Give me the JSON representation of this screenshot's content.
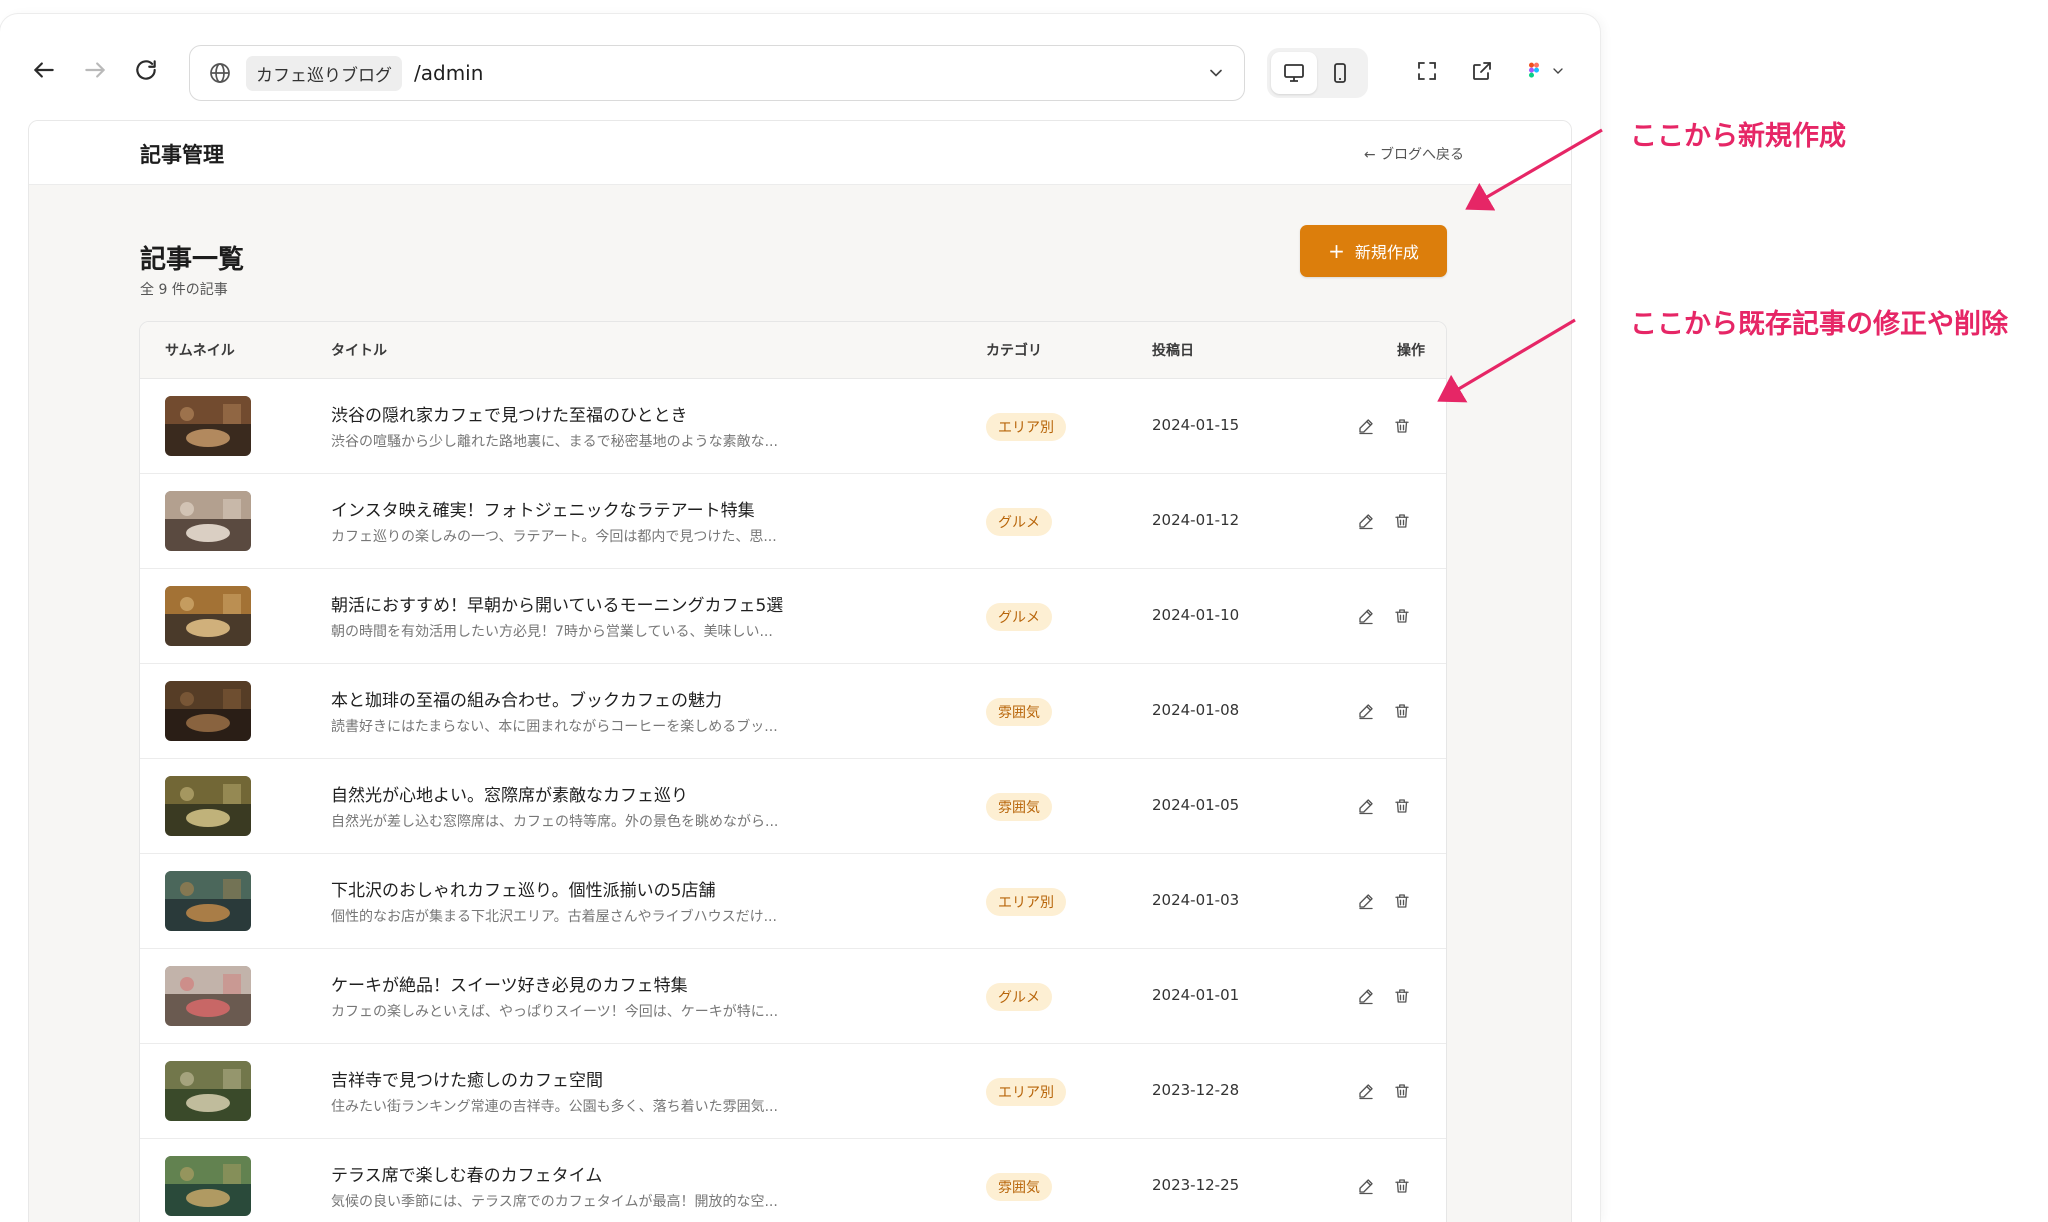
{
  "browser": {
    "site_label": "カフェ巡りブログ",
    "path": "/admin"
  },
  "page": {
    "header_title": "記事管理",
    "back_link": "← ブログへ戻る",
    "list_title": "記事一覧",
    "list_count": "全 9 件の記事",
    "new_button_label": "新規作成"
  },
  "table": {
    "headers": {
      "thumbnail": "サムネイル",
      "title": "タイトル",
      "category": "カテゴリ",
      "date": "投稿日",
      "actions": "操作"
    },
    "rows": [
      {
        "title": "渋谷の隠れ家カフェで見つけた至福のひととき",
        "excerpt": "渋谷の喧騒から少し離れた路地裏に、まるで秘密基地のような素敵な...",
        "category": "エリア別",
        "date": "2024-01-15"
      },
      {
        "title": "インスタ映え確実！フォトジェニックなラテアート特集",
        "excerpt": "カフェ巡りの楽しみの一つ、ラテアート。今回は都内で見つけた、思...",
        "category": "グルメ",
        "date": "2024-01-12"
      },
      {
        "title": "朝活におすすめ！早朝から開いているモーニングカフェ5選",
        "excerpt": "朝の時間を有効活用したい方必見！7時から営業している、美味しい...",
        "category": "グルメ",
        "date": "2024-01-10"
      },
      {
        "title": "本と珈琲の至福の組み合わせ。ブックカフェの魅力",
        "excerpt": "読書好きにはたまらない、本に囲まれながらコーヒーを楽しめるブッ...",
        "category": "雰囲気",
        "date": "2024-01-08"
      },
      {
        "title": "自然光が心地よい。窓際席が素敵なカフェ巡り",
        "excerpt": "自然光が差し込む窓際席は、カフェの特等席。外の景色を眺めながら...",
        "category": "雰囲気",
        "date": "2024-01-05"
      },
      {
        "title": "下北沢のおしゃれカフェ巡り。個性派揃いの5店舗",
        "excerpt": "個性的なお店が集まる下北沢エリア。古着屋さんやライブハウスだけ...",
        "category": "エリア別",
        "date": "2024-01-03"
      },
      {
        "title": "ケーキが絶品！スイーツ好き必見のカフェ特集",
        "excerpt": "カフェの楽しみといえば、やっぱりスイーツ！今回は、ケーキが特に...",
        "category": "グルメ",
        "date": "2024-01-01"
      },
      {
        "title": "吉祥寺で見つけた癒しのカフェ空間",
        "excerpt": "住みたい街ランキング常連の吉祥寺。公園も多く、落ち着いた雰囲気...",
        "category": "エリア別",
        "date": "2023-12-28"
      },
      {
        "title": "テラス席で楽しむ春のカフェタイム",
        "excerpt": "気候の良い季節には、テラス席でのカフェタイムが最高！開放的な空...",
        "category": "雰囲気",
        "date": "2023-12-25"
      }
    ]
  },
  "annotations": {
    "new": "ここから新規作成",
    "edit": "ここから既存記事の修正や削除"
  },
  "colors": {
    "accent": "#dc7e0c",
    "badge_bg": "#fdefd3",
    "badge_text": "#b8650a",
    "annotation": "#e62666"
  }
}
